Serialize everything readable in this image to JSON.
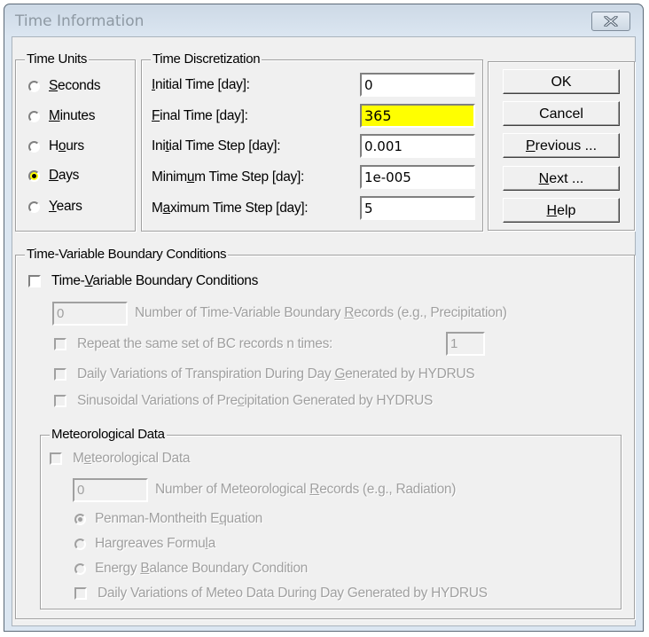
{
  "window": {
    "title": "Time Information",
    "close_icon": "close-x-icon"
  },
  "time_units": {
    "legend": "Time Units",
    "options": [
      {
        "pre": "",
        "u": "S",
        "post": "econds",
        "selected": false
      },
      {
        "pre": "",
        "u": "M",
        "post": "inutes",
        "selected": false
      },
      {
        "pre": "H",
        "u": "o",
        "post": "urs",
        "selected": false
      },
      {
        "pre": "",
        "u": "D",
        "post": "ays",
        "selected": true
      },
      {
        "pre": "",
        "u": "Y",
        "post": "ears",
        "selected": false
      }
    ]
  },
  "time_discretization": {
    "legend": "Time Discretization",
    "fields": [
      {
        "pre": "",
        "u": "I",
        "post": "nitial Time [day]:",
        "value": "0",
        "highlight": false
      },
      {
        "pre": "",
        "u": "F",
        "post": "inal Time [day]:",
        "value": "365",
        "highlight": true
      },
      {
        "pre": "Ini",
        "u": "t",
        "post": "ial Time Step [day]:",
        "value": "0.001",
        "highlight": false
      },
      {
        "pre": "Minim",
        "u": "u",
        "post": "m Time Step [day]:",
        "value": "1e-005",
        "highlight": false
      },
      {
        "pre": "M",
        "u": "a",
        "post": "ximum Time Step [day]:",
        "value": "5",
        "highlight": false
      }
    ],
    "highlight_color": "#ffff00"
  },
  "buttons": {
    "ok": {
      "pre": "",
      "u": "",
      "post": "OK"
    },
    "cancel": {
      "pre": "",
      "u": "",
      "post": "Cancel"
    },
    "previous": {
      "pre": "",
      "u": "P",
      "post": "revious ..."
    },
    "next": {
      "pre": "",
      "u": "N",
      "post": "ext ..."
    },
    "help": {
      "pre": "",
      "u": "H",
      "post": "elp"
    }
  },
  "tvbc": {
    "legend": "Time-Variable Boundary Conditions",
    "checkbox": {
      "pre": "Time-",
      "u": "V",
      "post": "ariable Boundary Conditions",
      "checked": false
    },
    "num_records": {
      "value": "0",
      "pre": "Number of Time-Variable Boundary ",
      "u": "R",
      "post": "ecords (e.g., Precipitation)"
    },
    "repeat": {
      "label": "Repeat the same set of BC records n times:",
      "value": "1",
      "checked": false
    },
    "daily_transpiration": {
      "pre": "Daily Variations of Transpiration During Day ",
      "u": "G",
      "post": "enerated by HYDRUS",
      "checked": false
    },
    "sinusoidal_precip": {
      "pre": "Sinusoidal Variations of Pre",
      "u": "c",
      "post": "ipitation Generated by HYDRUS",
      "checked": false
    }
  },
  "meteo": {
    "legend": "Meteorological Data",
    "checkbox": {
      "pre": "M",
      "u": "e",
      "post": "teorological Data",
      "checked": false
    },
    "num_records": {
      "value": "0",
      "pre": "Number of Meteorological ",
      "u": "R",
      "post": "ecords (e.g., Radiation)"
    },
    "methods": [
      {
        "pre": "Penman-Montheith E",
        "u": "q",
        "post": "uation",
        "selected": true
      },
      {
        "pre": "Hargreaves Formu",
        "u": "l",
        "post": "a",
        "selected": false
      },
      {
        "pre": "Energy ",
        "u": "B",
        "post": "alance Boundary Condition",
        "selected": false
      }
    ],
    "daily_meteo": {
      "label": "Daily Variations of Meteo Data During Day Generated by HYDRUS",
      "checked": false
    }
  }
}
